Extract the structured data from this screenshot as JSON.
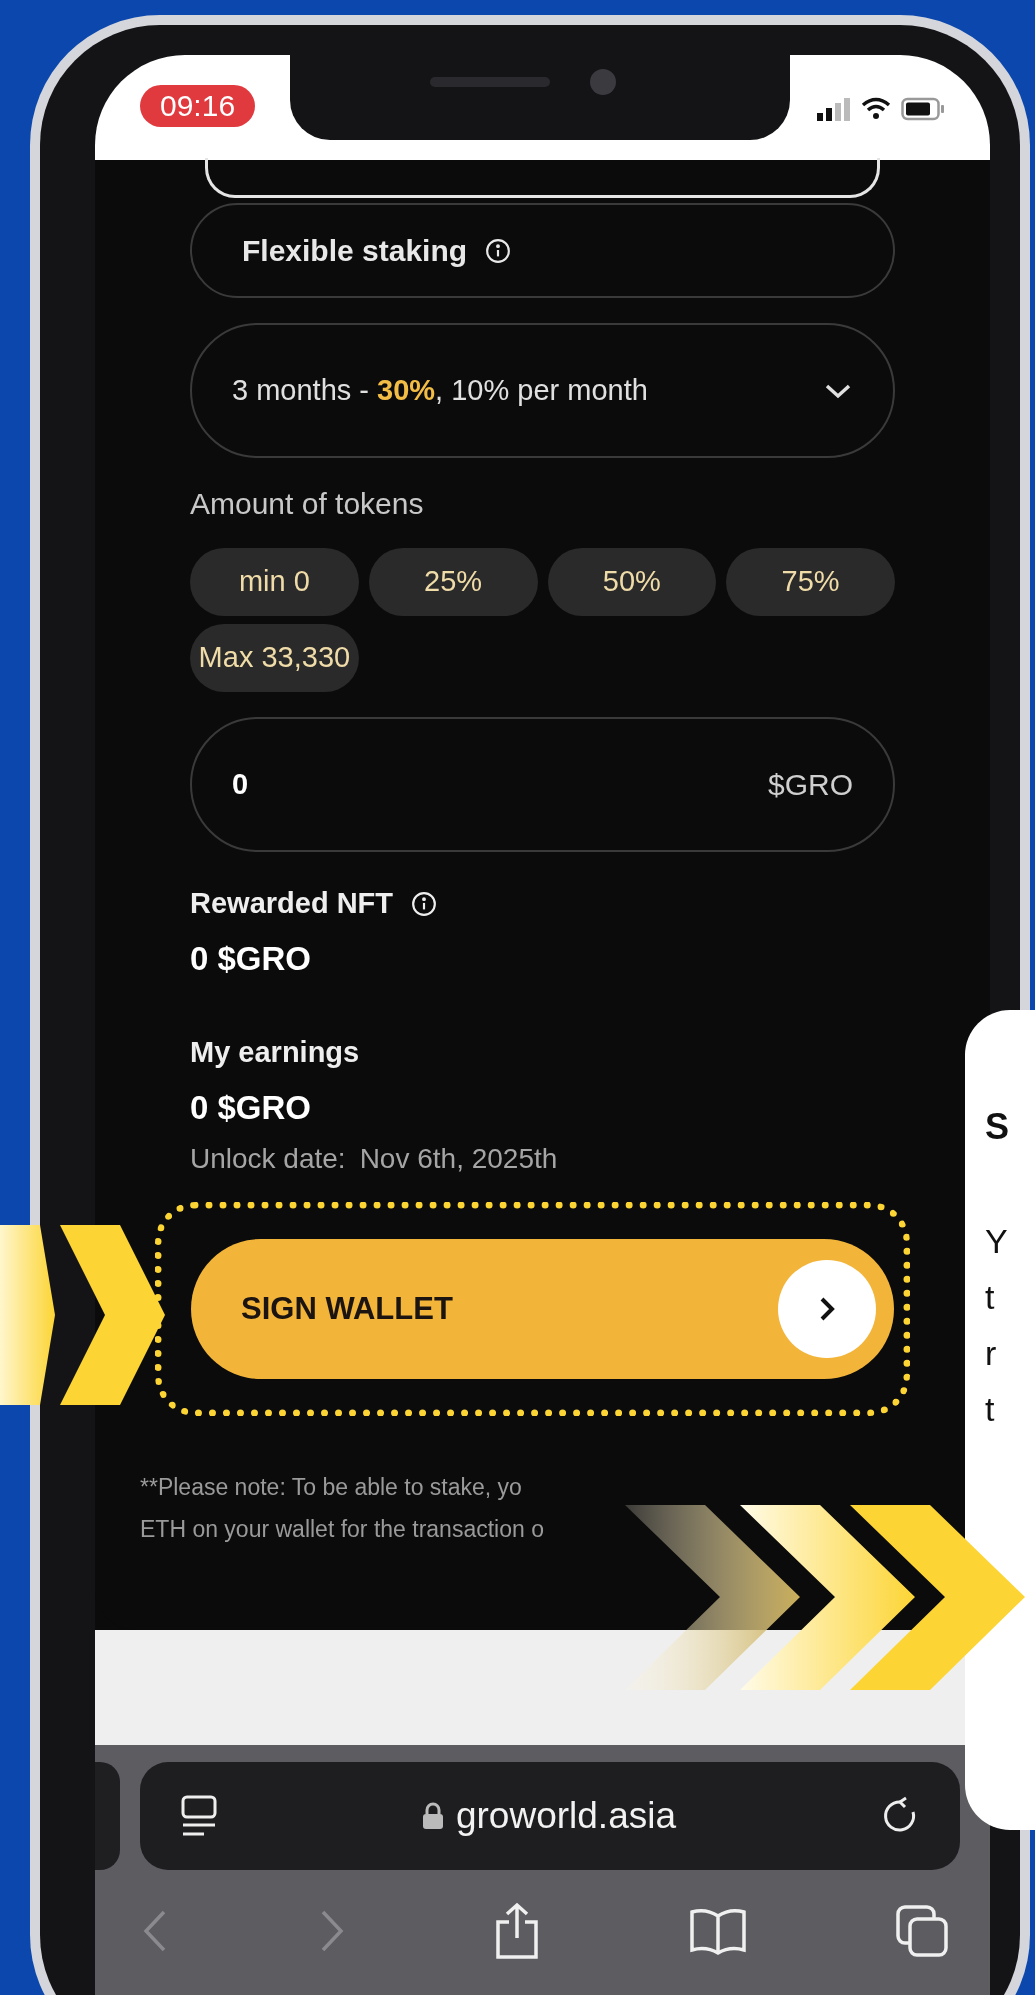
{
  "status_bar": {
    "time": "09:16"
  },
  "staking_type": {
    "label": "Flexible staking"
  },
  "period_select": {
    "value": "3 months - **30%**, 10% per month"
  },
  "amount": {
    "label": "Amount of tokens",
    "chips": [
      "min 0",
      "25%",
      "50%",
      "75%",
      "Max 33,330"
    ],
    "input": {
      "value": "0",
      "unit": "$GRO"
    }
  },
  "rewarded_nft": {
    "label": "Rewarded NFT",
    "value": "0 $GRO"
  },
  "earnings": {
    "label": "My earnings",
    "value": "0 $GRO",
    "unlock_label": "Unlock date:",
    "unlock_date": "Nov 6th, 2025th"
  },
  "sign_button": {
    "label": "SIGN WALLET",
    "highlighted": true
  },
  "note": [
    "**Please note: To be able to stake, yo",
    "ETH on your wallet for the transaction o"
  ],
  "browser": {
    "url": "groworld.asia"
  },
  "side_card": {
    "heading": "S",
    "lines": [
      "Y",
      "t",
      "r",
      "t"
    ]
  }
}
